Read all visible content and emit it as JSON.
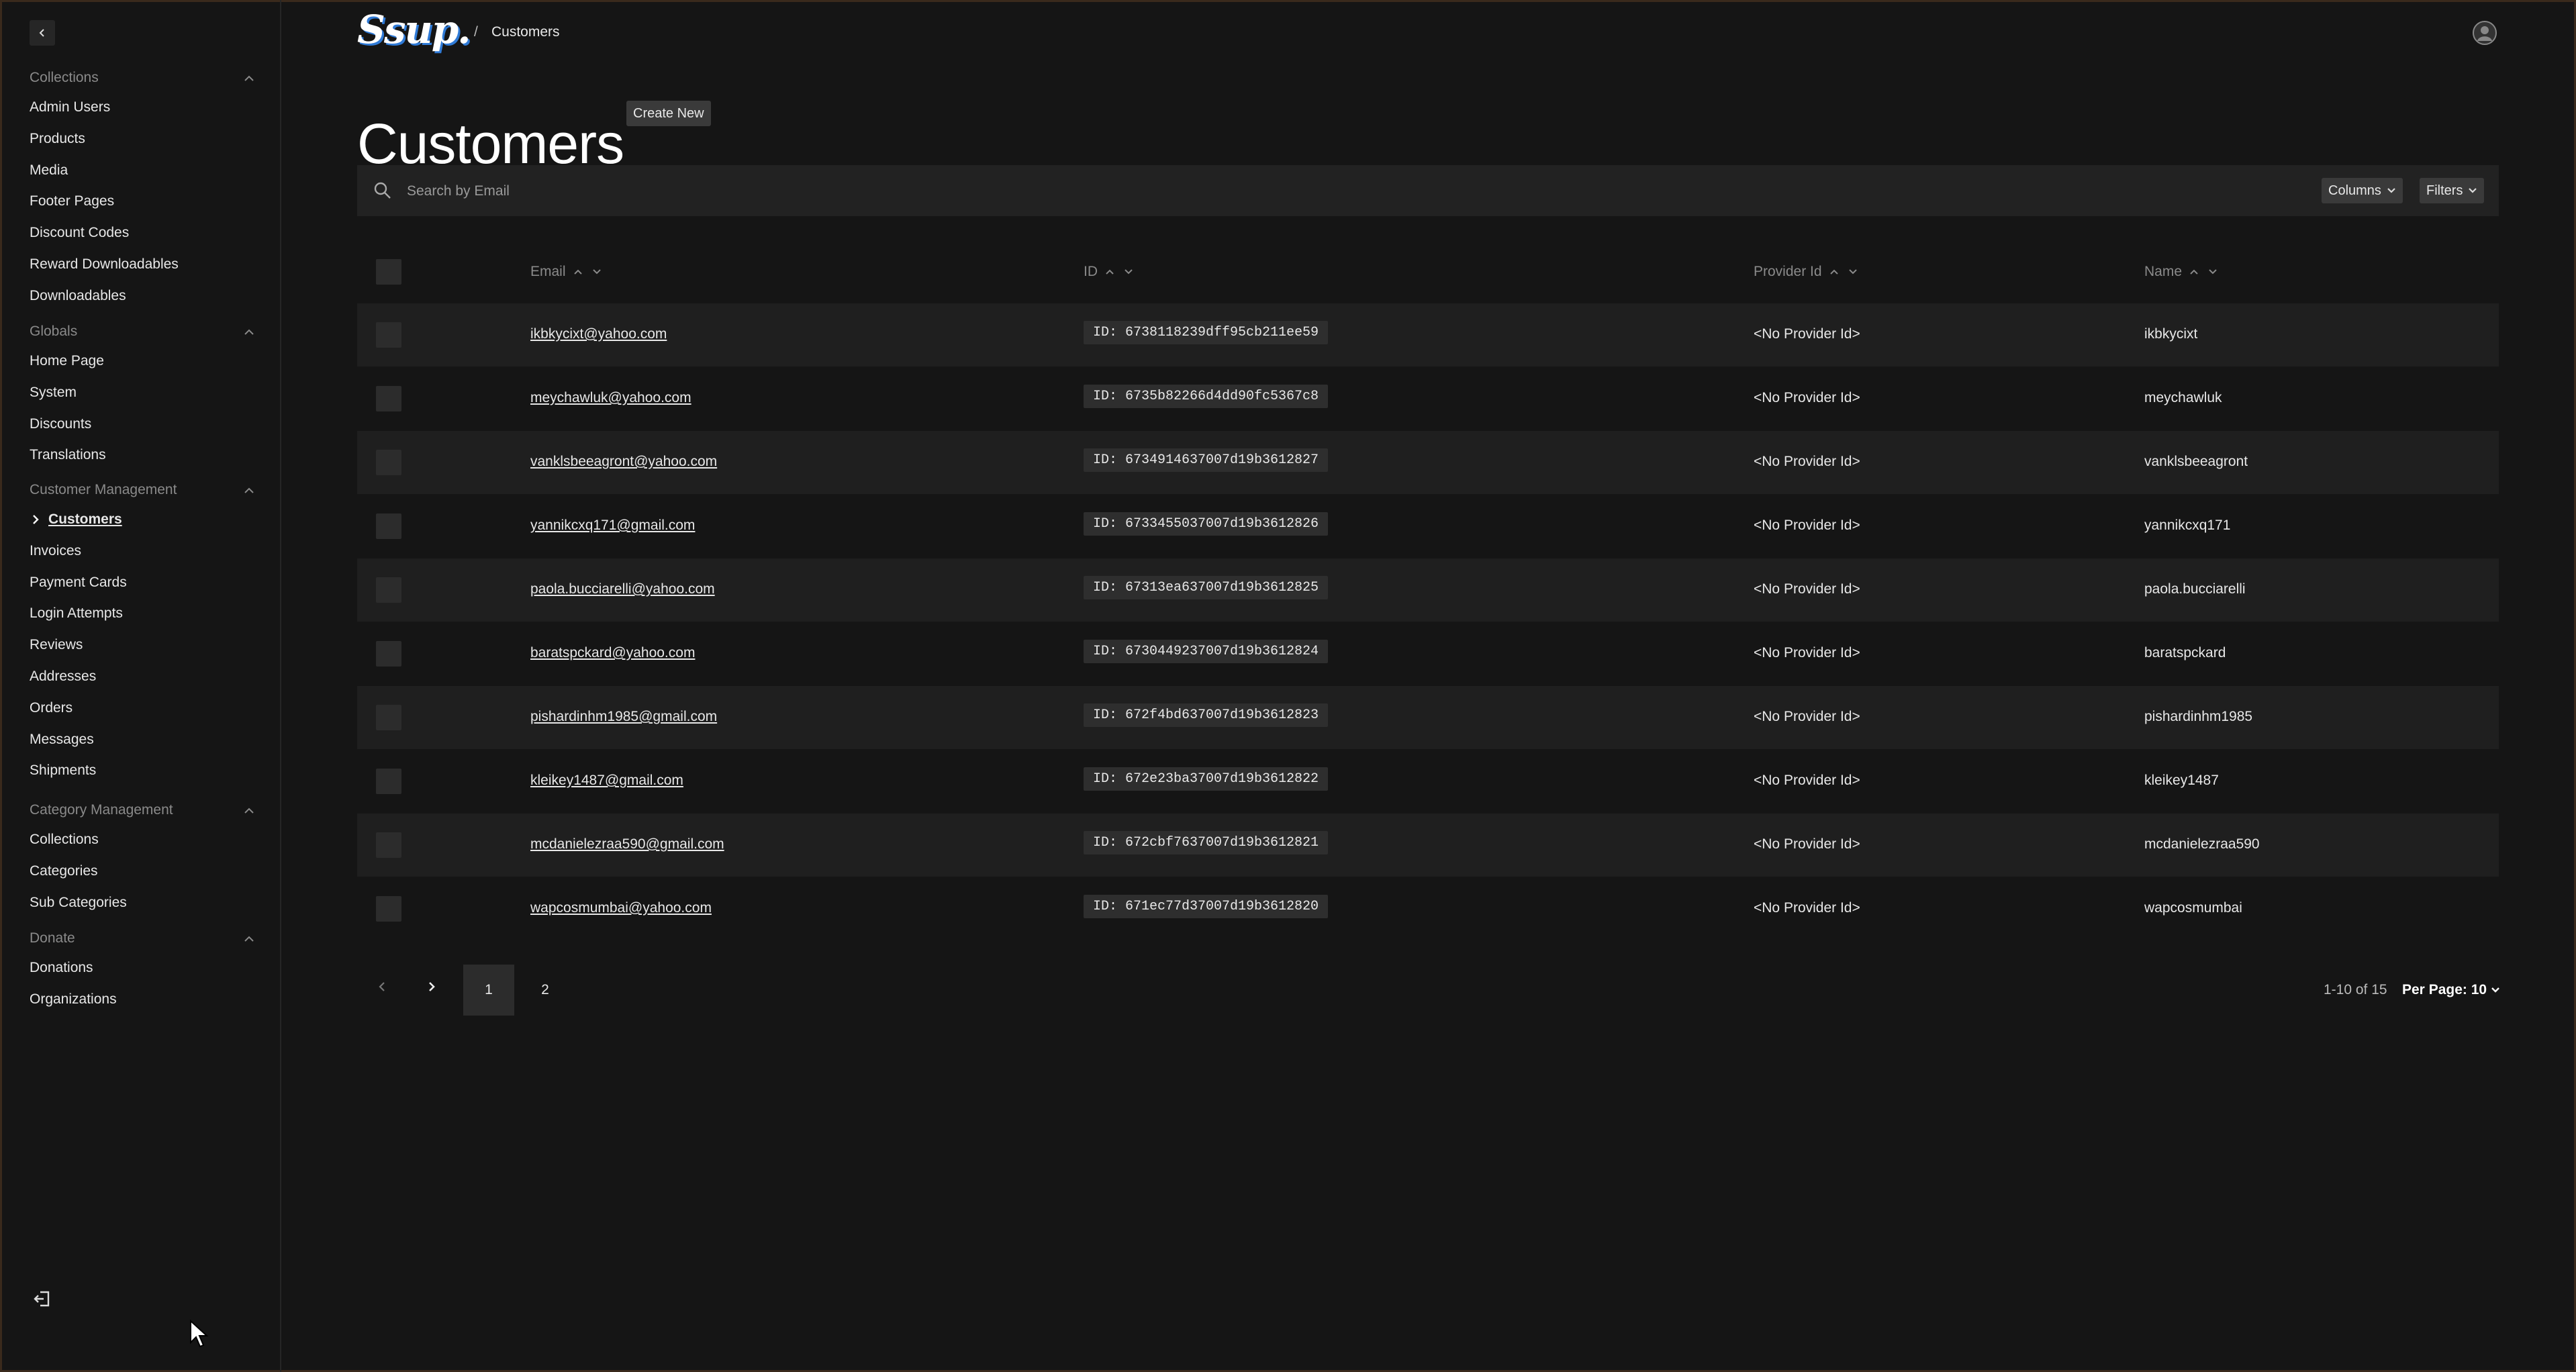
{
  "sidebar": {
    "groups": [
      {
        "label": "Collections",
        "items": [
          "Admin Users",
          "Products",
          "Media",
          "Footer Pages",
          "Discount Codes",
          "Reward Downloadables",
          "Downloadables"
        ]
      },
      {
        "label": "Globals",
        "items": [
          "Home Page",
          "System",
          "Discounts",
          "Translations"
        ]
      },
      {
        "label": "Customer Management",
        "items": [
          "Customers",
          "Invoices",
          "Payment Cards",
          "Login Attempts",
          "Reviews",
          "Addresses",
          "Orders",
          "Messages",
          "Shipments"
        ]
      },
      {
        "label": "Category Management",
        "items": [
          "Collections",
          "Categories",
          "Sub Categories"
        ]
      },
      {
        "label": "Donate",
        "items": [
          "Donations",
          "Organizations"
        ]
      }
    ],
    "active_item": "Customers"
  },
  "header": {
    "logo_text": "Ssup.",
    "breadcrumb_sep": "/",
    "breadcrumb": "Customers"
  },
  "page": {
    "title": "Customers",
    "create_label": "Create New"
  },
  "toolbar": {
    "search_placeholder": "Search by Email",
    "columns_label": "Columns",
    "filters_label": "Filters"
  },
  "table": {
    "headers": {
      "email": "Email",
      "id": "ID",
      "provider": "Provider Id",
      "name": "Name"
    },
    "rows": [
      {
        "email": "ikbkycixt@yahoo.com",
        "id": "ID: 6738118239dff95cb211ee59",
        "provider": "<No Provider Id>",
        "name": "ikbkycixt"
      },
      {
        "email": "meychawluk@yahoo.com",
        "id": "ID: 6735b82266d4dd90fc5367c8",
        "provider": "<No Provider Id>",
        "name": "meychawluk"
      },
      {
        "email": "vanklsbeeagront@yahoo.com",
        "id": "ID: 6734914637007d19b3612827",
        "provider": "<No Provider Id>",
        "name": "vanklsbeeagront"
      },
      {
        "email": "yannikcxq171@gmail.com",
        "id": "ID: 6733455037007d19b3612826",
        "provider": "<No Provider Id>",
        "name": "yannikcxq171"
      },
      {
        "email": "paola.bucciarelli@yahoo.com",
        "id": "ID: 67313ea637007d19b3612825",
        "provider": "<No Provider Id>",
        "name": "paola.bucciarelli"
      },
      {
        "email": "baratspckard@yahoo.com",
        "id": "ID: 6730449237007d19b3612824",
        "provider": "<No Provider Id>",
        "name": "baratspckard"
      },
      {
        "email": "pishardinhm1985@gmail.com",
        "id": "ID: 672f4bd637007d19b3612823",
        "provider": "<No Provider Id>",
        "name": "pishardinhm1985"
      },
      {
        "email": "kleikey1487@gmail.com",
        "id": "ID: 672e23ba37007d19b3612822",
        "provider": "<No Provider Id>",
        "name": "kleikey1487"
      },
      {
        "email": "mcdanielezraa590@gmail.com",
        "id": "ID: 672cbf7637007d19b3612821",
        "provider": "<No Provider Id>",
        "name": "mcdanielezraa590"
      },
      {
        "email": "wapcosmumbai@yahoo.com",
        "id": "ID: 671ec77d37007d19b3612820",
        "provider": "<No Provider Id>",
        "name": "wapcosmumbai"
      }
    ]
  },
  "pagination": {
    "pages": [
      "1",
      "2"
    ],
    "current": "1",
    "info": "1-10 of 15",
    "per_page": "Per Page: 10"
  },
  "icons": {
    "collapse": "chevron-left-icon",
    "group": "chevron-up-icon",
    "active": "chevron-right-icon",
    "search": "search-icon",
    "avatar": "user-circle-icon",
    "logout": "logout-icon"
  }
}
